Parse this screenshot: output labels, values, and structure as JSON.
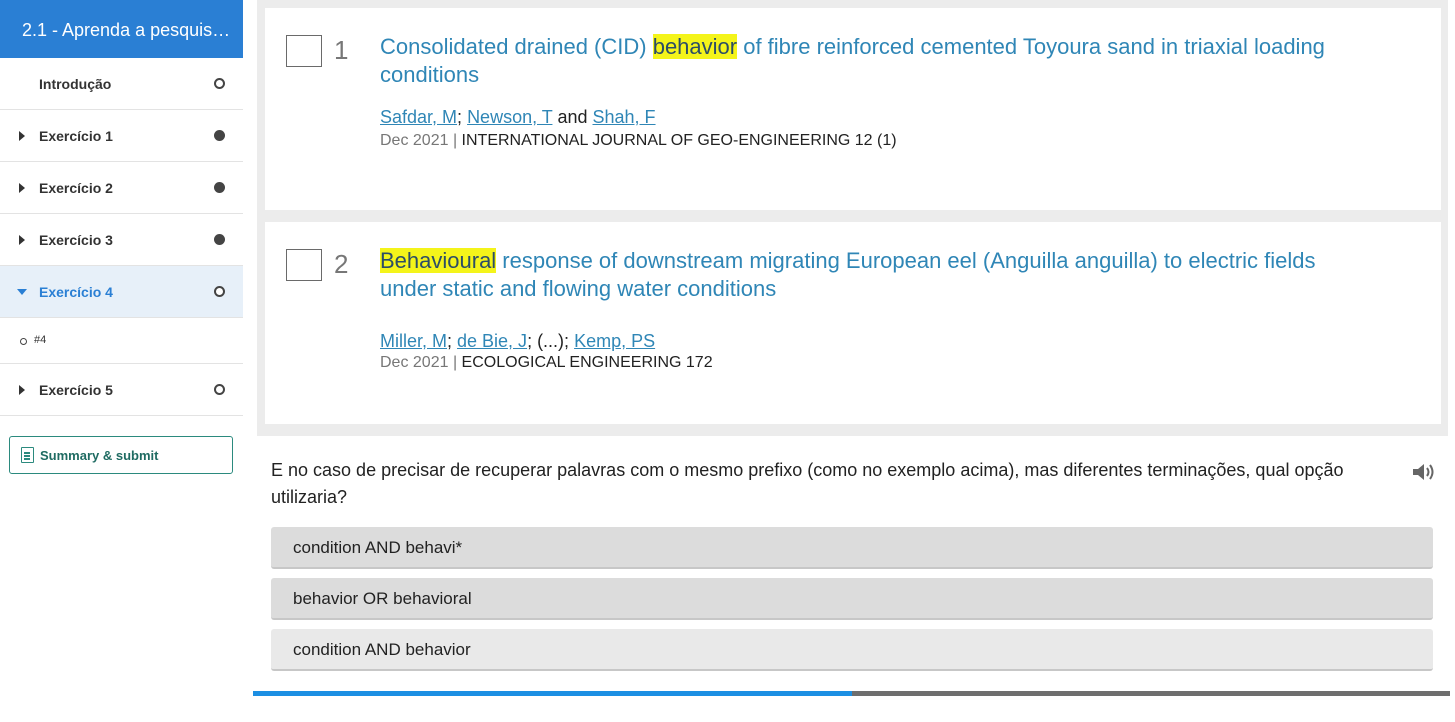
{
  "sidebar": {
    "title": "2.1 - Aprenda a pesquis…",
    "items": [
      {
        "label": "Introdução",
        "status": "empty"
      },
      {
        "label": "Exercício 1",
        "status": "filled"
      },
      {
        "label": "Exercício 2",
        "status": "filled"
      },
      {
        "label": "Exercício 3",
        "status": "filled"
      },
      {
        "label": "Exercício 4",
        "status": "empty"
      },
      {
        "label": "Exercício 5",
        "status": "empty"
      }
    ],
    "subitem": "#4",
    "summary_button": "Summary & submit"
  },
  "results": [
    {
      "number": "1",
      "title_pre": "Consolidated drained (CID) ",
      "title_highlight": "behavior",
      "title_post": " of fibre reinforced cemented Toyoura sand in triaxial loading conditions",
      "authors": [
        {
          "name": "Safdar, M",
          "sep": "; "
        },
        {
          "name": "Newson, T",
          "sep": " and "
        },
        {
          "name": "Shah, F",
          "sep": ""
        }
      ],
      "date": "Dec 2021",
      "journal": "INTERNATIONAL JOURNAL OF GEO-ENGINEERING 12 (1)"
    },
    {
      "number": "2",
      "title_pre": "",
      "title_highlight": "Behavioural",
      "title_post": " response of downstream migrating European eel (Anguilla anguilla) to electric fields under static and flowing water conditions",
      "authors": [
        {
          "name": "Miller, M",
          "sep": "; "
        },
        {
          "name": "de Bie, J",
          "sep": "; (...); "
        },
        {
          "name": "Kemp, PS",
          "sep": ""
        }
      ],
      "date": "Dec 2021",
      "journal": "ECOLOGICAL ENGINEERING 172"
    }
  ],
  "question": "E no caso de precisar de recuperar palavras com o mesmo prefixo (como no exemplo acima), mas diferentes terminações, qual opção utilizaria?",
  "answers": [
    "condition AND behavi*",
    "behavior OR behavioral",
    "condition AND behavior"
  ],
  "progress": 0.5,
  "colors": {
    "accent": "#2a7fd4",
    "highlight": "#f4f41a",
    "link": "#2f86b6",
    "progress": "#1c8fe3"
  }
}
